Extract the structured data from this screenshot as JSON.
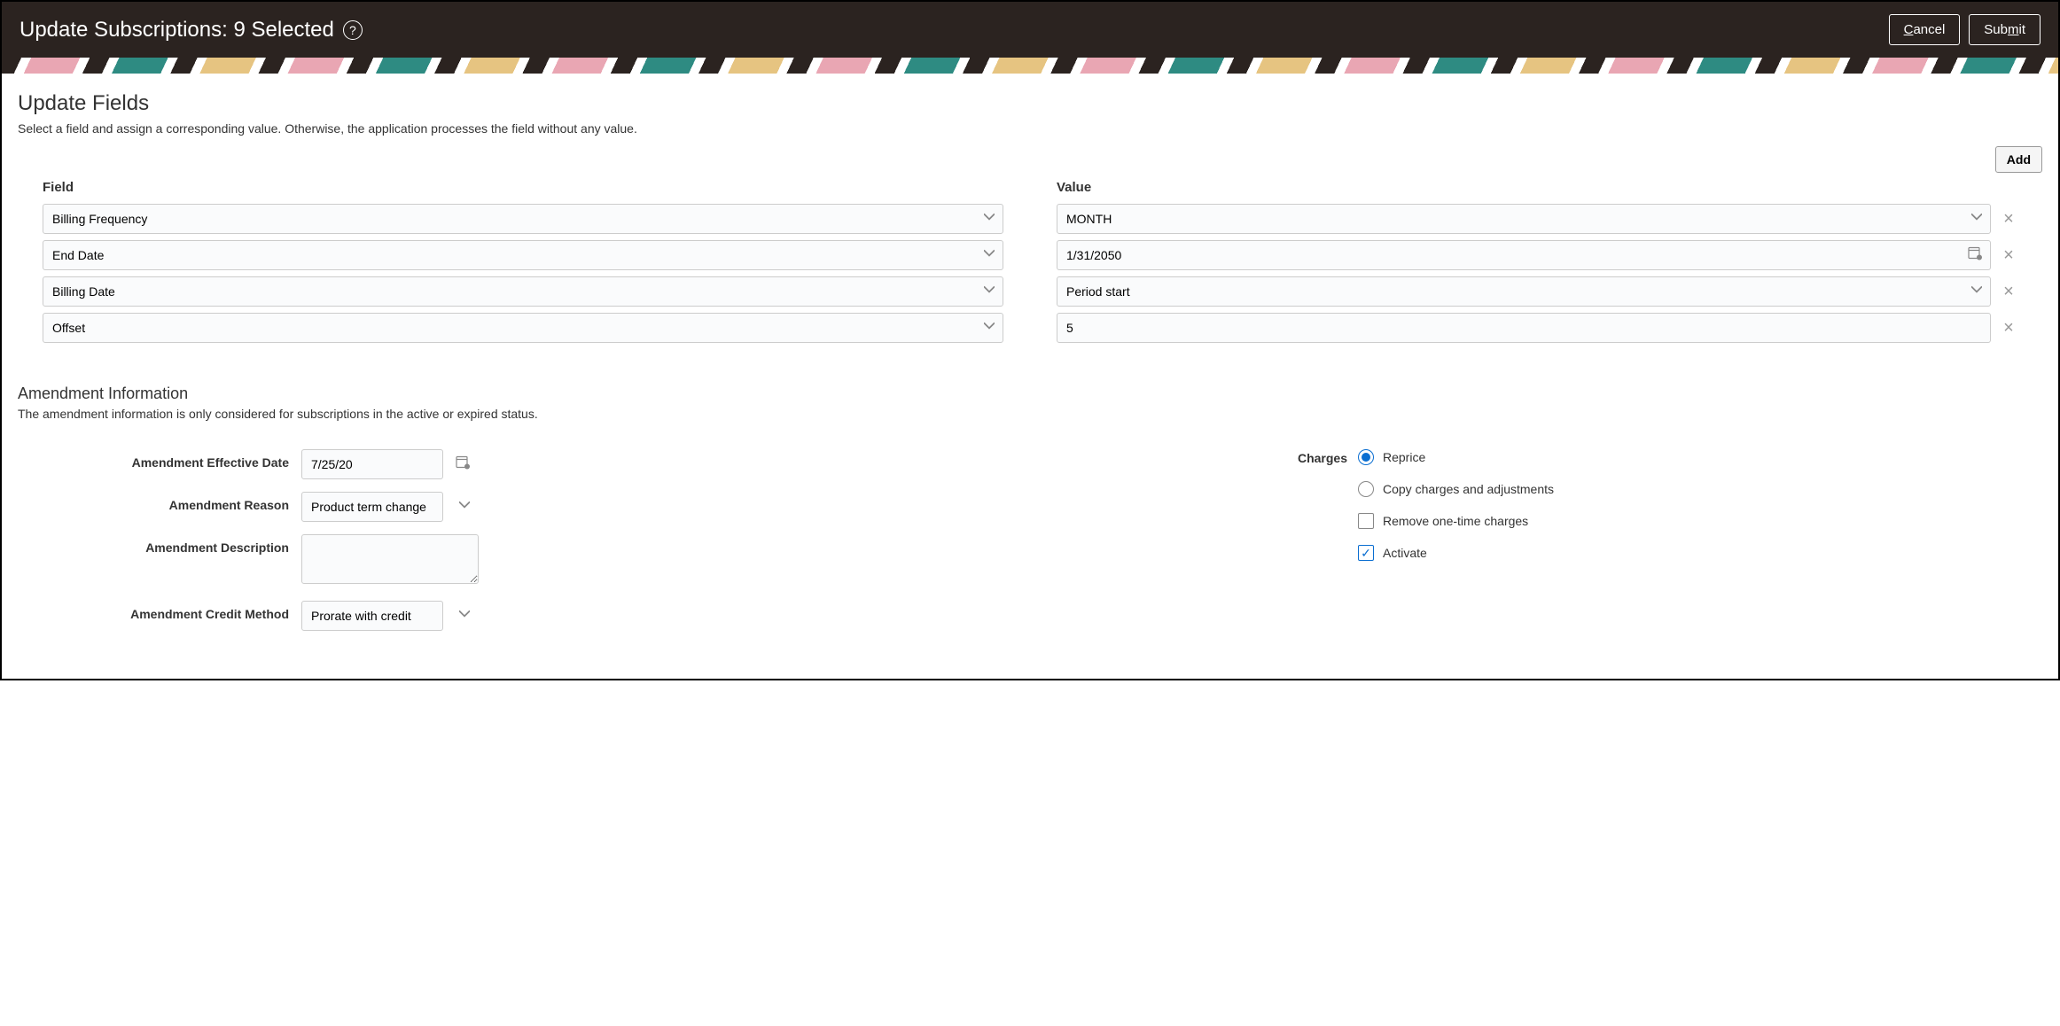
{
  "header": {
    "title": "Update Subscriptions: 9 Selected",
    "cancel": "Cancel",
    "submit": "Submit"
  },
  "updateFields": {
    "title": "Update Fields",
    "desc": "Select a field and assign a corresponding value. Otherwise, the application processes the field without any value.",
    "addLabel": "Add",
    "fieldHeader": "Field",
    "valueHeader": "Value",
    "rows": [
      {
        "field": "Billing Frequency",
        "value": "MONTH",
        "type": "select"
      },
      {
        "field": "End Date",
        "value": "1/31/2050",
        "type": "date"
      },
      {
        "field": "Billing Date",
        "value": "Period start",
        "type": "select"
      },
      {
        "field": "Offset",
        "value": "5",
        "type": "text"
      }
    ]
  },
  "amendment": {
    "title": "Amendment Information",
    "desc": "The amendment information is only considered for subscriptions in the active or expired status.",
    "effectiveDateLabel": "Amendment Effective Date",
    "effectiveDate": "7/25/20",
    "reasonLabel": "Amendment Reason",
    "reason": "Product term change",
    "descriptionLabel": "Amendment Description",
    "description": "",
    "creditMethodLabel": "Amendment Credit Method",
    "creditMethod": "Prorate with credit"
  },
  "charges": {
    "label": "Charges",
    "reprice": "Reprice",
    "copy": "Copy charges and adjustments",
    "removeOnetime": "Remove one-time charges",
    "activate": "Activate",
    "selectedRadio": "reprice",
    "removeChecked": false,
    "activateChecked": true
  }
}
